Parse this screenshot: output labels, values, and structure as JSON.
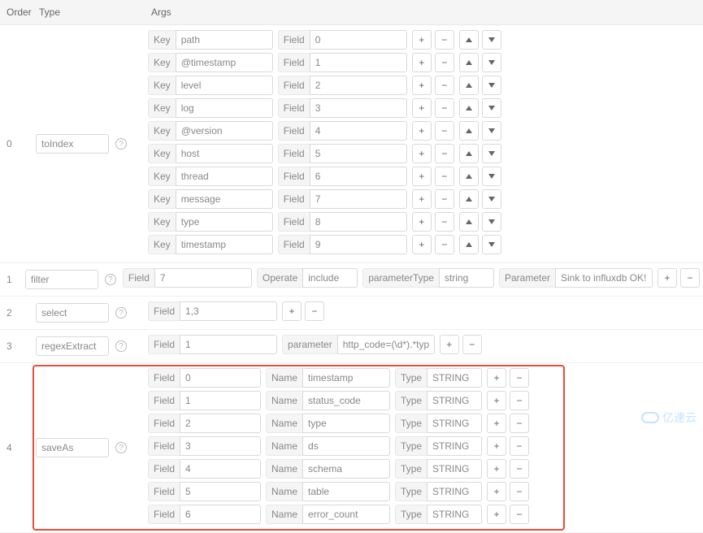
{
  "columns": {
    "order": "Order",
    "type": "Type",
    "args": "Args"
  },
  "labels": {
    "key": "Key",
    "field": "Field",
    "name": "Name",
    "type": "Type",
    "operate": "Operate",
    "parameterType": "parameterType",
    "parameter": "Parameter",
    "parameter_lc": "parameter"
  },
  "rows": [
    {
      "order": "0",
      "type": "toIndex",
      "items": [
        {
          "key": "path",
          "field": "0"
        },
        {
          "key": "@timestamp",
          "field": "1"
        },
        {
          "key": "level",
          "field": "2"
        },
        {
          "key": "log",
          "field": "3"
        },
        {
          "key": "@version",
          "field": "4"
        },
        {
          "key": "host",
          "field": "5"
        },
        {
          "key": "thread",
          "field": "6"
        },
        {
          "key": "message",
          "field": "7"
        },
        {
          "key": "type",
          "field": "8"
        },
        {
          "key": "timestamp",
          "field": "9"
        }
      ]
    },
    {
      "order": "1",
      "type": "filter",
      "field": "7",
      "operate": "include",
      "parameterType": "string",
      "parameterValue": "Sink to influxdb OK!"
    },
    {
      "order": "2",
      "type": "select",
      "field": "1,3"
    },
    {
      "order": "3",
      "type": "regexExtract",
      "field": "1",
      "parameter": "http_code=(\\d*).*type=(.*),"
    },
    {
      "order": "4",
      "type": "saveAs",
      "items": [
        {
          "field": "0",
          "name": "timestamp",
          "type": "STRING"
        },
        {
          "field": "1",
          "name": "status_code",
          "type": "STRING"
        },
        {
          "field": "2",
          "name": "type",
          "type": "STRING"
        },
        {
          "field": "3",
          "name": "ds",
          "type": "STRING"
        },
        {
          "field": "4",
          "name": "schema",
          "type": "STRING"
        },
        {
          "field": "5",
          "name": "table",
          "type": "STRING"
        },
        {
          "field": "6",
          "name": "error_count",
          "type": "STRING"
        }
      ]
    }
  ],
  "watermark": "亿速云"
}
